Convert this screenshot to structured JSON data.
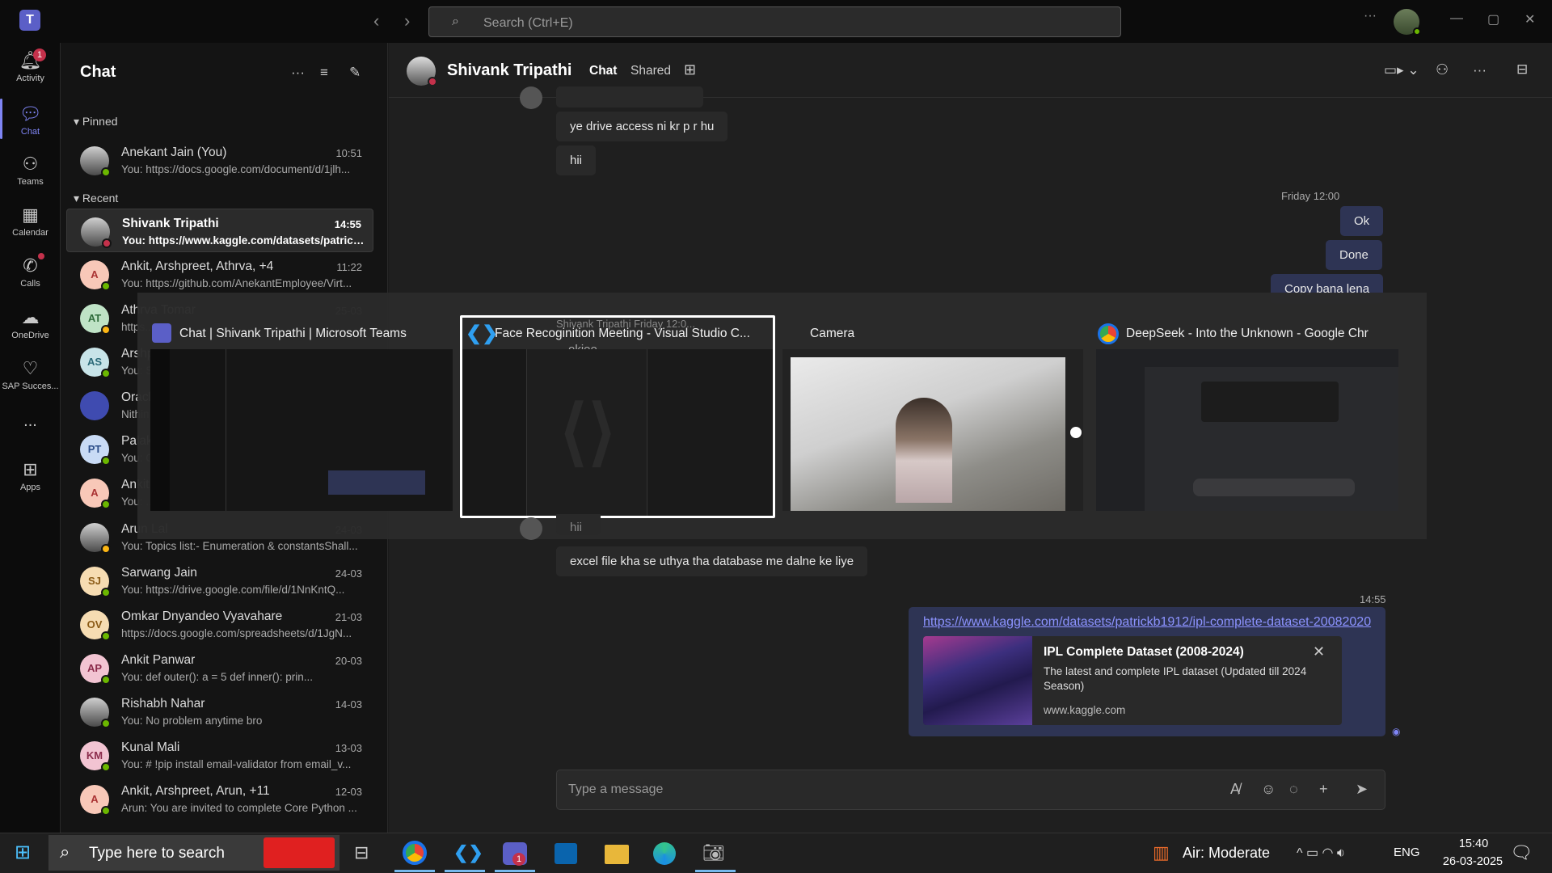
{
  "titlebar": {
    "search_placeholder": "Search (Ctrl+E)"
  },
  "rail": {
    "activity": "Activity",
    "activity_badge": "1",
    "chat": "Chat",
    "teams": "Teams",
    "calendar": "Calendar",
    "calls": "Calls",
    "onedrive": "OneDrive",
    "sap": "SAP Succes...",
    "more": "...",
    "apps": "Apps"
  },
  "chatlist": {
    "title": "Chat",
    "pinned": "Pinned",
    "recent": "Recent",
    "items": [
      {
        "name": "Anekant Jain (You)",
        "time": "10:51",
        "preview": "You: https://docs.google.com/document/d/1jlh...",
        "initials": "",
        "status": "green"
      },
      {
        "name": "Shivank Tripathi",
        "time": "14:55",
        "preview": "You: https://www.kaggle.com/datasets/patrickb...",
        "initials": "",
        "status": "red"
      },
      {
        "name": "Ankit, Arshpreet, Athrva, +4",
        "time": "11:22",
        "preview": "You: https://github.com/AnekantEmployee/Virt...",
        "initials": "A"
      },
      {
        "name": "Athrva Tomar",
        "time": "25-03",
        "preview": "https...",
        "initials": "AT"
      },
      {
        "name": "Arshp...",
        "time": "",
        "preview": "You: S...",
        "initials": "AS"
      },
      {
        "name": "Oracl...",
        "time": "",
        "preview": "Nithin...",
        "initials": ""
      },
      {
        "name": "Palak...",
        "time": "",
        "preview": "You: G...",
        "initials": "PT"
      },
      {
        "name": "Ankit...",
        "time": "",
        "preview": "You: ...",
        "initials": "A"
      },
      {
        "name": "Arun Lal",
        "time": "24-03",
        "preview": "You: Topics list:- Enumeration & constantsShall...",
        "initials": ""
      },
      {
        "name": "Sarwang Jain",
        "time": "24-03",
        "preview": "You: https://drive.google.com/file/d/1NnKntQ...",
        "initials": "SJ"
      },
      {
        "name": "Omkar Dnyandeo Vyavahare",
        "time": "21-03",
        "preview": "https://docs.google.com/spreadsheets/d/1JgN...",
        "initials": "OV"
      },
      {
        "name": "Ankit Panwar",
        "time": "20-03",
        "preview": "You: def outer():     a = 5     def inner():       prin...",
        "initials": "AP"
      },
      {
        "name": "Rishabh Nahar",
        "time": "14-03",
        "preview": "You: No problem anytime bro",
        "initials": ""
      },
      {
        "name": "Kunal Mali",
        "time": "13-03",
        "preview": "You: # !pip install email-validator   from email_v...",
        "initials": "KM"
      },
      {
        "name": "Ankit, Arshpreet, Arun, +11",
        "time": "12-03",
        "preview": "Arun: You are invited to complete Core Python ...",
        "initials": "A"
      }
    ]
  },
  "conversation": {
    "name": "Shivank Tripathi",
    "tab_chat": "Chat",
    "tab_shared": "Shared",
    "msg1": "ye drive access ni kr p r hu",
    "msg2": "hii",
    "ts_friday": "Friday 12:00",
    "me1": "Ok",
    "me2": "Done",
    "me3": "Copy bana lena",
    "behind_name": "Shivank Tripathi   Friday 12:0...",
    "behind_msg": "okiee",
    "msg3": "hii",
    "msg4": "excel file kha se uthya tha database me dalne ke liye",
    "ts2": "14:55",
    "link": "https://www.kaggle.com/datasets/patrickb1912/ipl-complete-dataset-20082020",
    "card_title": "IPL Complete Dataset (2008-2024)",
    "card_desc": "The latest and complete IPL dataset (Updated till 2024 Season)",
    "card_domain": "www.kaggle.com",
    "compose_placeholder": "Type a message"
  },
  "switcher": {
    "windows": [
      {
        "title": "Chat | Shivank Tripathi | Microsoft Teams"
      },
      {
        "title": "Face Recoginition Meeting - Visual Studio C..."
      },
      {
        "title": "Camera"
      },
      {
        "title": "DeepSeek - Into the Unknown - Google Chr..."
      }
    ]
  },
  "taskbar": {
    "search": "Type here to search",
    "weather": "Air: Moderate",
    "lang": "ENG",
    "time": "15:40",
    "date": "26-03-2025",
    "teams_badge": "1"
  },
  "colors": {
    "accent": "#7f85f5",
    "mine": "#2e3454",
    "bubble": "#292929"
  }
}
